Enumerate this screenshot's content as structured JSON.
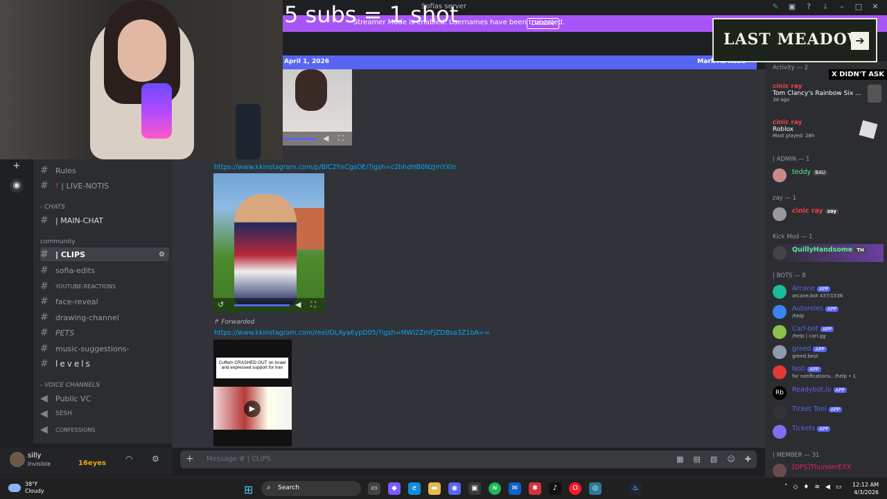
{
  "window": {
    "title": "Sofias server"
  },
  "overlay": {
    "top_text": "5 subs = 1 shot",
    "last_meadow": "LAST MEADOW",
    "x_didnt_ask": "X DIDN'T ASK"
  },
  "streamer_banner": {
    "message": "Streamer Mode is enabled. Usernames have been truncated.",
    "disable_label": "Disable"
  },
  "datebar": {
    "date": "April 1, 2026",
    "mark": "Mark As Read"
  },
  "channels": {
    "rules": "Rules",
    "live_notis": "| LIVE-NOTIS",
    "live_notis_icon": "!",
    "chats_category": "- CHATS",
    "main_chat": "| MAIN-CHAT",
    "community_category": "community",
    "clips": "| CLIPS",
    "sofia_edits": "sofia-edits",
    "youtube_reactions": "YOUTUBE-REACTIONS",
    "face_reveal": "face-reveal",
    "drawing_channel": "drawing-channel",
    "pets": "PETS",
    "music_suggestions": "music-suggestions-",
    "levels": "levels",
    "voice_category": "- VOICE CHANNELS",
    "public_vc": "Public VC",
    "sesh": "SESH",
    "confessions": "CONFESSIONS"
  },
  "userpanel": {
    "username": "silly",
    "status": "Invisible",
    "overlay_text": "16eyes"
  },
  "messages": {
    "link1": "https://www.kkinstagram.com/p/BlC2YnCgsOE/?igsh=c2hhdHB0NzJmYXln",
    "forwarded": "Forwarded",
    "link2": "https://www.kkinstagram.com/reel/DLAya6ypD05/?igsh=MWl2ZmFjZDBsa3Z1bA==",
    "video_title": "Cuffem CRASHED OUT on Israel and expressed support for Iran"
  },
  "composer": {
    "placeholder": "Message #  | CLIPS"
  },
  "members": {
    "activity_header": "Activity — 2",
    "activity1_name": "cinic ray",
    "activity1_title": "Tom Clancy's Rainbow Six ...",
    "activity1_sub": "3d ago",
    "activity2_name": "cinic ray",
    "activity2_title": "Roblox",
    "activity2_sub": "Most played: 28h",
    "admin_header": "| ADMIN — 1",
    "teddy": "teddy",
    "teddy_tag": "BAU",
    "zay_header": "zay — 1",
    "zay_name": "cinic ray",
    "zay_tag": "zay",
    "kickmod_header": "Kick Mod — 1",
    "quilly": "QuillyHandsome",
    "quilly_tag": "TH",
    "bots_header": "| BOTS — 8",
    "bots": [
      {
        "name": "Arcane",
        "sub": "arcane.bot 437/1536",
        "color": "#5865f2"
      },
      {
        "name": "Autoroles",
        "sub": "/help",
        "color": "#5865f2"
      },
      {
        "name": "Carl-bot",
        "sub": "/help | carl.gg",
        "color": "#5865f2"
      },
      {
        "name": "greed",
        "sub": "greed.best",
        "color": "#5865f2"
      },
      {
        "name": "Noti",
        "sub": "for notifications.. /help • 1",
        "color": "#5865f2"
      },
      {
        "name": "Readybot.io",
        "sub": "",
        "color": "#5865f2"
      },
      {
        "name": "Ticket Tool",
        "sub": "",
        "color": "#5865f2"
      },
      {
        "name": "Tickets",
        "sub": "",
        "color": "#5865f2"
      }
    ],
    "app_tag": "APP",
    "member_header": "| MEMBER — 31",
    "member1": "[DPS]ThunderEXX"
  },
  "taskbar": {
    "temp": "38°F",
    "weather": "Cloudy",
    "search": "Search",
    "time": "12:12 AM",
    "date": "4/3/2026"
  }
}
